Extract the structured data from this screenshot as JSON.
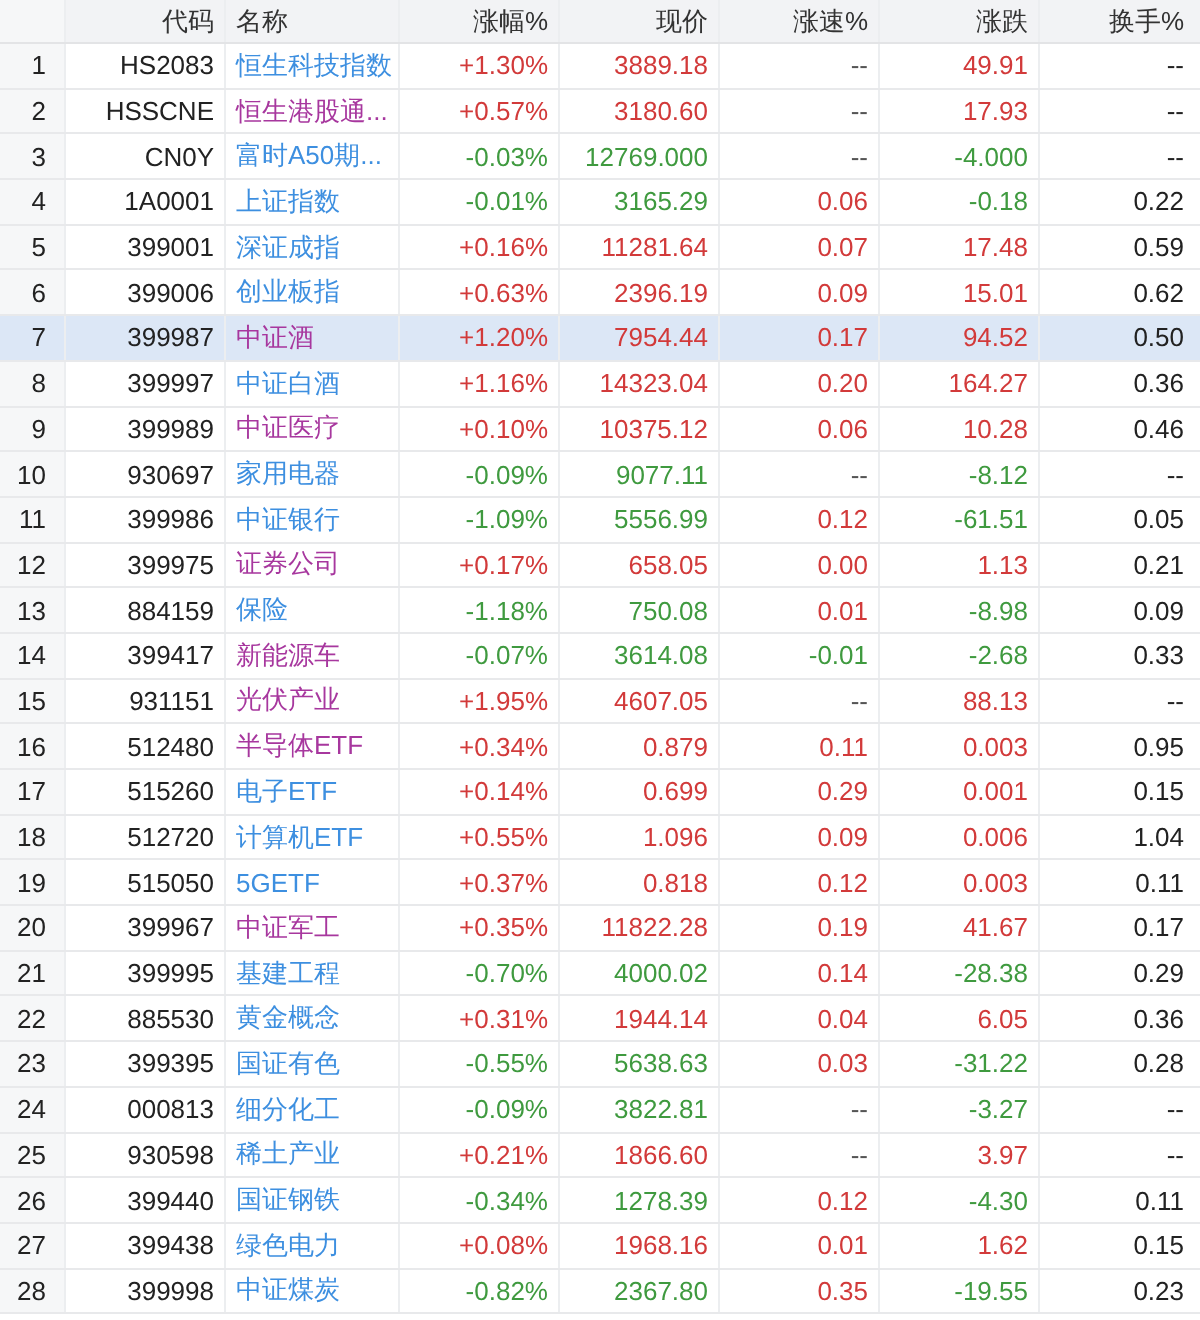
{
  "table": {
    "columns": [
      "代码",
      "名称",
      "涨幅%",
      "现价",
      "涨速%",
      "涨跌",
      "换手%"
    ],
    "rows": [
      {
        "no": "1",
        "code": "HS2083",
        "name": "恒生科技指数",
        "color": "#3d8fe0",
        "rising": true,
        "change_pct": "+1.30%",
        "price": "3889.18",
        "speed": "--",
        "change": "49.91",
        "turnover": "--",
        "selected": false
      },
      {
        "no": "2",
        "code": "HSSCNE",
        "name": "恒生港股通...",
        "color": "#a7379e",
        "rising": true,
        "change_pct": "+0.57%",
        "price": "3180.60",
        "speed": "--",
        "change": "17.93",
        "turnover": "--",
        "selected": false
      },
      {
        "no": "3",
        "code": "CN0Y",
        "name": "富时A50期...",
        "color": "#3d8fe0",
        "rising": false,
        "change_pct": "-0.03%",
        "price": "12769.000",
        "speed": "--",
        "change": "-4.000",
        "turnover": "--",
        "selected": false
      },
      {
        "no": "4",
        "code": "1A0001",
        "name": "上证指数",
        "color": "#3d8fe0",
        "rising": false,
        "change_pct": "-0.01%",
        "price": "3165.29",
        "speed": "0.06",
        "speed_rising": true,
        "change": "-0.18",
        "turnover": "0.22",
        "selected": false
      },
      {
        "no": "5",
        "code": "399001",
        "name": "深证成指",
        "color": "#3d8fe0",
        "rising": true,
        "change_pct": "+0.16%",
        "price": "11281.64",
        "speed": "0.07",
        "speed_rising": true,
        "change": "17.48",
        "turnover": "0.59",
        "selected": false
      },
      {
        "no": "6",
        "code": "399006",
        "name": "创业板指",
        "color": "#3d8fe0",
        "rising": true,
        "change_pct": "+0.63%",
        "price": "2396.19",
        "speed": "0.09",
        "speed_rising": true,
        "change": "15.01",
        "turnover": "0.62",
        "selected": false
      },
      {
        "no": "7",
        "code": "399987",
        "name": "中证酒",
        "color": "#a7379e",
        "rising": true,
        "change_pct": "+1.20%",
        "price": "7954.44",
        "speed": "0.17",
        "speed_rising": true,
        "change": "94.52",
        "turnover": "0.50",
        "selected": true
      },
      {
        "no": "8",
        "code": "399997",
        "name": "中证白酒",
        "color": "#3d8fe0",
        "rising": true,
        "change_pct": "+1.16%",
        "price": "14323.04",
        "speed": "0.20",
        "speed_rising": true,
        "change": "164.27",
        "turnover": "0.36",
        "selected": false
      },
      {
        "no": "9",
        "code": "399989",
        "name": "中证医疗",
        "color": "#a7379e",
        "rising": true,
        "change_pct": "+0.10%",
        "price": "10375.12",
        "speed": "0.06",
        "speed_rising": true,
        "change": "10.28",
        "turnover": "0.46",
        "selected": false
      },
      {
        "no": "10",
        "code": "930697",
        "name": "家用电器",
        "color": "#3d8fe0",
        "rising": false,
        "change_pct": "-0.09%",
        "price": "9077.11",
        "speed": "--",
        "change": "-8.12",
        "turnover": "--",
        "selected": false
      },
      {
        "no": "11",
        "code": "399986",
        "name": "中证银行",
        "color": "#3d8fe0",
        "rising": false,
        "change_pct": "-1.09%",
        "price": "5556.99",
        "speed": "0.12",
        "speed_rising": true,
        "change": "-61.51",
        "turnover": "0.05",
        "selected": false
      },
      {
        "no": "12",
        "code": "399975",
        "name": "证券公司",
        "color": "#a7379e",
        "rising": true,
        "change_pct": "+0.17%",
        "price": "658.05",
        "speed": "0.00",
        "speed_rising": true,
        "change": "1.13",
        "turnover": "0.21",
        "selected": false
      },
      {
        "no": "13",
        "code": "884159",
        "name": "保险",
        "color": "#3d8fe0",
        "rising": false,
        "change_pct": "-1.18%",
        "price": "750.08",
        "speed": "0.01",
        "speed_rising": true,
        "change": "-8.98",
        "turnover": "0.09",
        "selected": false
      },
      {
        "no": "14",
        "code": "399417",
        "name": "新能源车",
        "color": "#a7379e",
        "rising": false,
        "change_pct": "-0.07%",
        "price": "3614.08",
        "speed": "-0.01",
        "speed_rising": false,
        "change": "-2.68",
        "turnover": "0.33",
        "selected": false
      },
      {
        "no": "15",
        "code": "931151",
        "name": "光伏产业",
        "color": "#a7379e",
        "rising": true,
        "change_pct": "+1.95%",
        "price": "4607.05",
        "speed": "--",
        "change": "88.13",
        "turnover": "--",
        "selected": false
      },
      {
        "no": "16",
        "code": "512480",
        "name": "半导体ETF",
        "color": "#a7379e",
        "rising": true,
        "change_pct": "+0.34%",
        "price": "0.879",
        "speed": "0.11",
        "speed_rising": true,
        "change": "0.003",
        "turnover": "0.95",
        "selected": false
      },
      {
        "no": "17",
        "code": "515260",
        "name": "电子ETF",
        "color": "#3d8fe0",
        "rising": true,
        "change_pct": "+0.14%",
        "price": "0.699",
        "speed": "0.29",
        "speed_rising": true,
        "change": "0.001",
        "turnover": "0.15",
        "selected": false
      },
      {
        "no": "18",
        "code": "512720",
        "name": "计算机ETF",
        "color": "#3d8fe0",
        "rising": true,
        "change_pct": "+0.55%",
        "price": "1.096",
        "speed": "0.09",
        "speed_rising": true,
        "change": "0.006",
        "turnover": "1.04",
        "selected": false
      },
      {
        "no": "19",
        "code": "515050",
        "name": "5GETF",
        "color": "#3d8fe0",
        "rising": true,
        "change_pct": "+0.37%",
        "price": "0.818",
        "speed": "0.12",
        "speed_rising": true,
        "change": "0.003",
        "turnover": "0.11",
        "selected": false
      },
      {
        "no": "20",
        "code": "399967",
        "name": "中证军工",
        "color": "#a7379e",
        "rising": true,
        "change_pct": "+0.35%",
        "price": "11822.28",
        "speed": "0.19",
        "speed_rising": true,
        "change": "41.67",
        "turnover": "0.17",
        "selected": false
      },
      {
        "no": "21",
        "code": "399995",
        "name": "基建工程",
        "color": "#3d8fe0",
        "rising": false,
        "change_pct": "-0.70%",
        "price": "4000.02",
        "speed": "0.14",
        "speed_rising": true,
        "change": "-28.38",
        "turnover": "0.29",
        "selected": false
      },
      {
        "no": "22",
        "code": "885530",
        "name": "黄金概念",
        "color": "#3d8fe0",
        "rising": true,
        "change_pct": "+0.31%",
        "price": "1944.14",
        "speed": "0.04",
        "speed_rising": true,
        "change": "6.05",
        "turnover": "0.36",
        "selected": false
      },
      {
        "no": "23",
        "code": "399395",
        "name": "国证有色",
        "color": "#3d8fe0",
        "rising": false,
        "change_pct": "-0.55%",
        "price": "5638.63",
        "speed": "0.03",
        "speed_rising": true,
        "change": "-31.22",
        "turnover": "0.28",
        "selected": false
      },
      {
        "no": "24",
        "code": "000813",
        "name": "细分化工",
        "color": "#3d8fe0",
        "rising": false,
        "change_pct": "-0.09%",
        "price": "3822.81",
        "speed": "--",
        "change": "-3.27",
        "turnover": "--",
        "selected": false
      },
      {
        "no": "25",
        "code": "930598",
        "name": "稀土产业",
        "color": "#3d8fe0",
        "rising": true,
        "change_pct": "+0.21%",
        "price": "1866.60",
        "speed": "--",
        "change": "3.97",
        "turnover": "--",
        "selected": false
      },
      {
        "no": "26",
        "code": "399440",
        "name": "国证钢铁",
        "color": "#3d8fe0",
        "rising": false,
        "change_pct": "-0.34%",
        "price": "1278.39",
        "speed": "0.12",
        "speed_rising": true,
        "change": "-4.30",
        "turnover": "0.11",
        "selected": false
      },
      {
        "no": "27",
        "code": "399438",
        "name": "绿色电力",
        "color": "#3d8fe0",
        "rising": true,
        "change_pct": "+0.08%",
        "price": "1968.16",
        "speed": "0.01",
        "speed_rising": true,
        "change": "1.62",
        "turnover": "0.15",
        "selected": false
      },
      {
        "no": "28",
        "code": "399998",
        "name": "中证煤炭",
        "color": "#3d8fe0",
        "rising": false,
        "change_pct": "-0.82%",
        "price": "2367.80",
        "speed": "0.35",
        "speed_rising": true,
        "change": "-19.55",
        "turnover": "0.23",
        "selected": false
      }
    ]
  }
}
